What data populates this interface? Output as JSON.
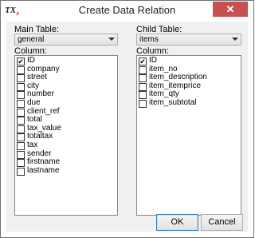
{
  "window": {
    "title": "Create Data Relation",
    "icon_text": "TX",
    "icon_badge": "x",
    "close_label": "✕"
  },
  "main": {
    "table_label": "Main Table:",
    "table_value": "general",
    "column_label": "Column:",
    "columns": [
      {
        "label": "ID",
        "checked": true
      },
      {
        "label": "company",
        "checked": false
      },
      {
        "label": "street",
        "checked": false
      },
      {
        "label": "city",
        "checked": false
      },
      {
        "label": "number",
        "checked": false
      },
      {
        "label": "due",
        "checked": false
      },
      {
        "label": "client_ref",
        "checked": false
      },
      {
        "label": "total",
        "checked": false
      },
      {
        "label": "tax_value",
        "checked": false
      },
      {
        "label": "totaltax",
        "checked": false
      },
      {
        "label": "tax",
        "checked": false
      },
      {
        "label": "sender",
        "checked": false
      },
      {
        "label": "firstname",
        "checked": false
      },
      {
        "label": "lastname",
        "checked": false
      }
    ]
  },
  "child": {
    "table_label": "Child Table:",
    "table_value": "items",
    "column_label": "Column:",
    "columns": [
      {
        "label": "ID",
        "checked": true
      },
      {
        "label": "item_no",
        "checked": false
      },
      {
        "label": "item_description",
        "checked": false
      },
      {
        "label": "item_itemprice",
        "checked": false
      },
      {
        "label": "item_qty",
        "checked": false
      },
      {
        "label": "item_subtotal",
        "checked": false
      }
    ]
  },
  "buttons": {
    "ok_label": "OK",
    "cancel_label": "Cancel"
  }
}
